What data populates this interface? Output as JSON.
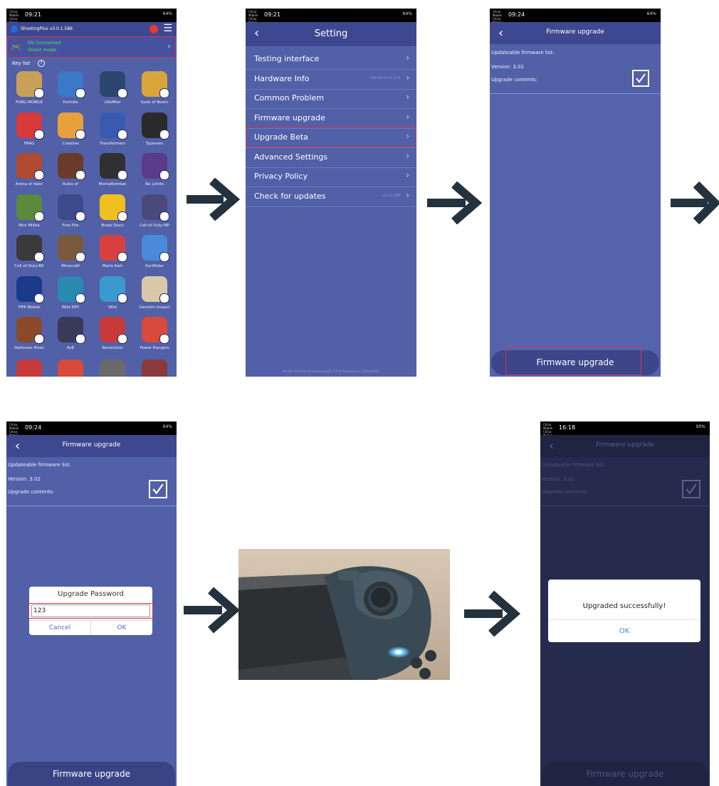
{
  "status": {
    "carrier": "China Mobile China Mobile",
    "time1": "09:21",
    "time2": "09:24",
    "time3": "16:18",
    "battery1": "64%",
    "battery3": "90%"
  },
  "screen1": {
    "app_title": "ShootingPlus v3.0.1.586",
    "connection": "Db Connected",
    "mode": "Direct mode",
    "key_list_label": "Key list",
    "games": [
      {
        "name": "PUBG MOBILE",
        "color": "#c8a058"
      },
      {
        "name": "Fortnite",
        "color": "#3a78c8"
      },
      {
        "name": "LifeAfter",
        "color": "#2d4670"
      },
      {
        "name": "Gods of Boom",
        "color": "#d9a53b"
      },
      {
        "name": "FRAG",
        "color": "#d83a3a"
      },
      {
        "name": "Creative",
        "color": "#e8a03a"
      },
      {
        "name": "Transformers",
        "color": "#3a5ab0"
      },
      {
        "name": "Typoman",
        "color": "#2a2a2a"
      },
      {
        "name": "Arena of Valor",
        "color": "#b04a30"
      },
      {
        "name": "Rules of",
        "color": "#6a3a2a"
      },
      {
        "name": "MortalKombat",
        "color": "#303030"
      },
      {
        "name": "No Limits",
        "color": "#5a3a8a"
      },
      {
        "name": "Mini Militia",
        "color": "#5a8a3a"
      },
      {
        "name": "Free Fire",
        "color": "#3a4a8a"
      },
      {
        "name": "Brawl Stars",
        "color": "#f0c020"
      },
      {
        "name": "Call of Duty-MP",
        "color": "#4a4a7a"
      },
      {
        "name": "Call of Duty-BR",
        "color": "#3a3a3a"
      },
      {
        "name": "Minecraft",
        "color": "#7a5a3a"
      },
      {
        "name": "Mario Kart",
        "color": "#d84040"
      },
      {
        "name": "KartRider",
        "color": "#4a8ad8"
      },
      {
        "name": "FIFA Mobile",
        "color": "#1a3a8a"
      },
      {
        "name": "Wild RIFt",
        "color": "#2a8ab0"
      },
      {
        "name": "Wild",
        "color": "#3a9ad0"
      },
      {
        "name": "Genshin Impact",
        "color": "#d8c8a8"
      },
      {
        "name": "Darkness Rises",
        "color": "#8a4a2a"
      },
      {
        "name": "AvE",
        "color": "#3a3a5a"
      },
      {
        "name": "Revolution",
        "color": "#c83a3a"
      },
      {
        "name": "Power Rangers",
        "color": "#d84a3a"
      }
    ]
  },
  "screen2": {
    "title": "Setting",
    "items": [
      {
        "label": "Testing interface",
        "value": ""
      },
      {
        "label": "Hardware Info",
        "value": "7E9-06-43-6   3.01"
      },
      {
        "label": "Common Problem",
        "value": ""
      },
      {
        "label": "Firmware upgrade",
        "value": ""
      },
      {
        "label": "Upgrade Beta",
        "value": ""
      },
      {
        "label": "Advanced Settings",
        "value": ""
      },
      {
        "label": "Privacy Policy",
        "value": ""
      },
      {
        "label": "Check for updates",
        "value": "v3.0.1.586"
      }
    ],
    "footer": "Model: VOG-AL00   HarmonyOS: 5.0.0   Resolution: 2340x1080"
  },
  "screen3": {
    "title": "Firmware upgrade",
    "list_label": "Updateable firmware list:",
    "version": "Version: 3.02",
    "contents": "Upgrade contents:",
    "button": "Firmware upgrade"
  },
  "screen4": {
    "title": "Firmware upgrade",
    "list_label": "Updateable firmware list:",
    "version": "Version: 3.02",
    "contents": "Upgrade contents:",
    "dialog_title": "Upgrade Password",
    "password": "123",
    "cancel": "Cancel",
    "ok": "OK",
    "button": "Firmware upgrade"
  },
  "screen6": {
    "title": "Firmware upgrade",
    "list_label": "Updateable firmware list:",
    "version": "Version: 3.01",
    "contents": "Upgrade contents:",
    "message": "Upgraded successfully!",
    "ok": "OK",
    "button": "Firmware upgrade"
  },
  "colors": {
    "accent": "#5260a8",
    "bar": "#3e4890",
    "highlight": "#d3384a",
    "arrow": "#24323d",
    "dark": "#262b4e"
  }
}
